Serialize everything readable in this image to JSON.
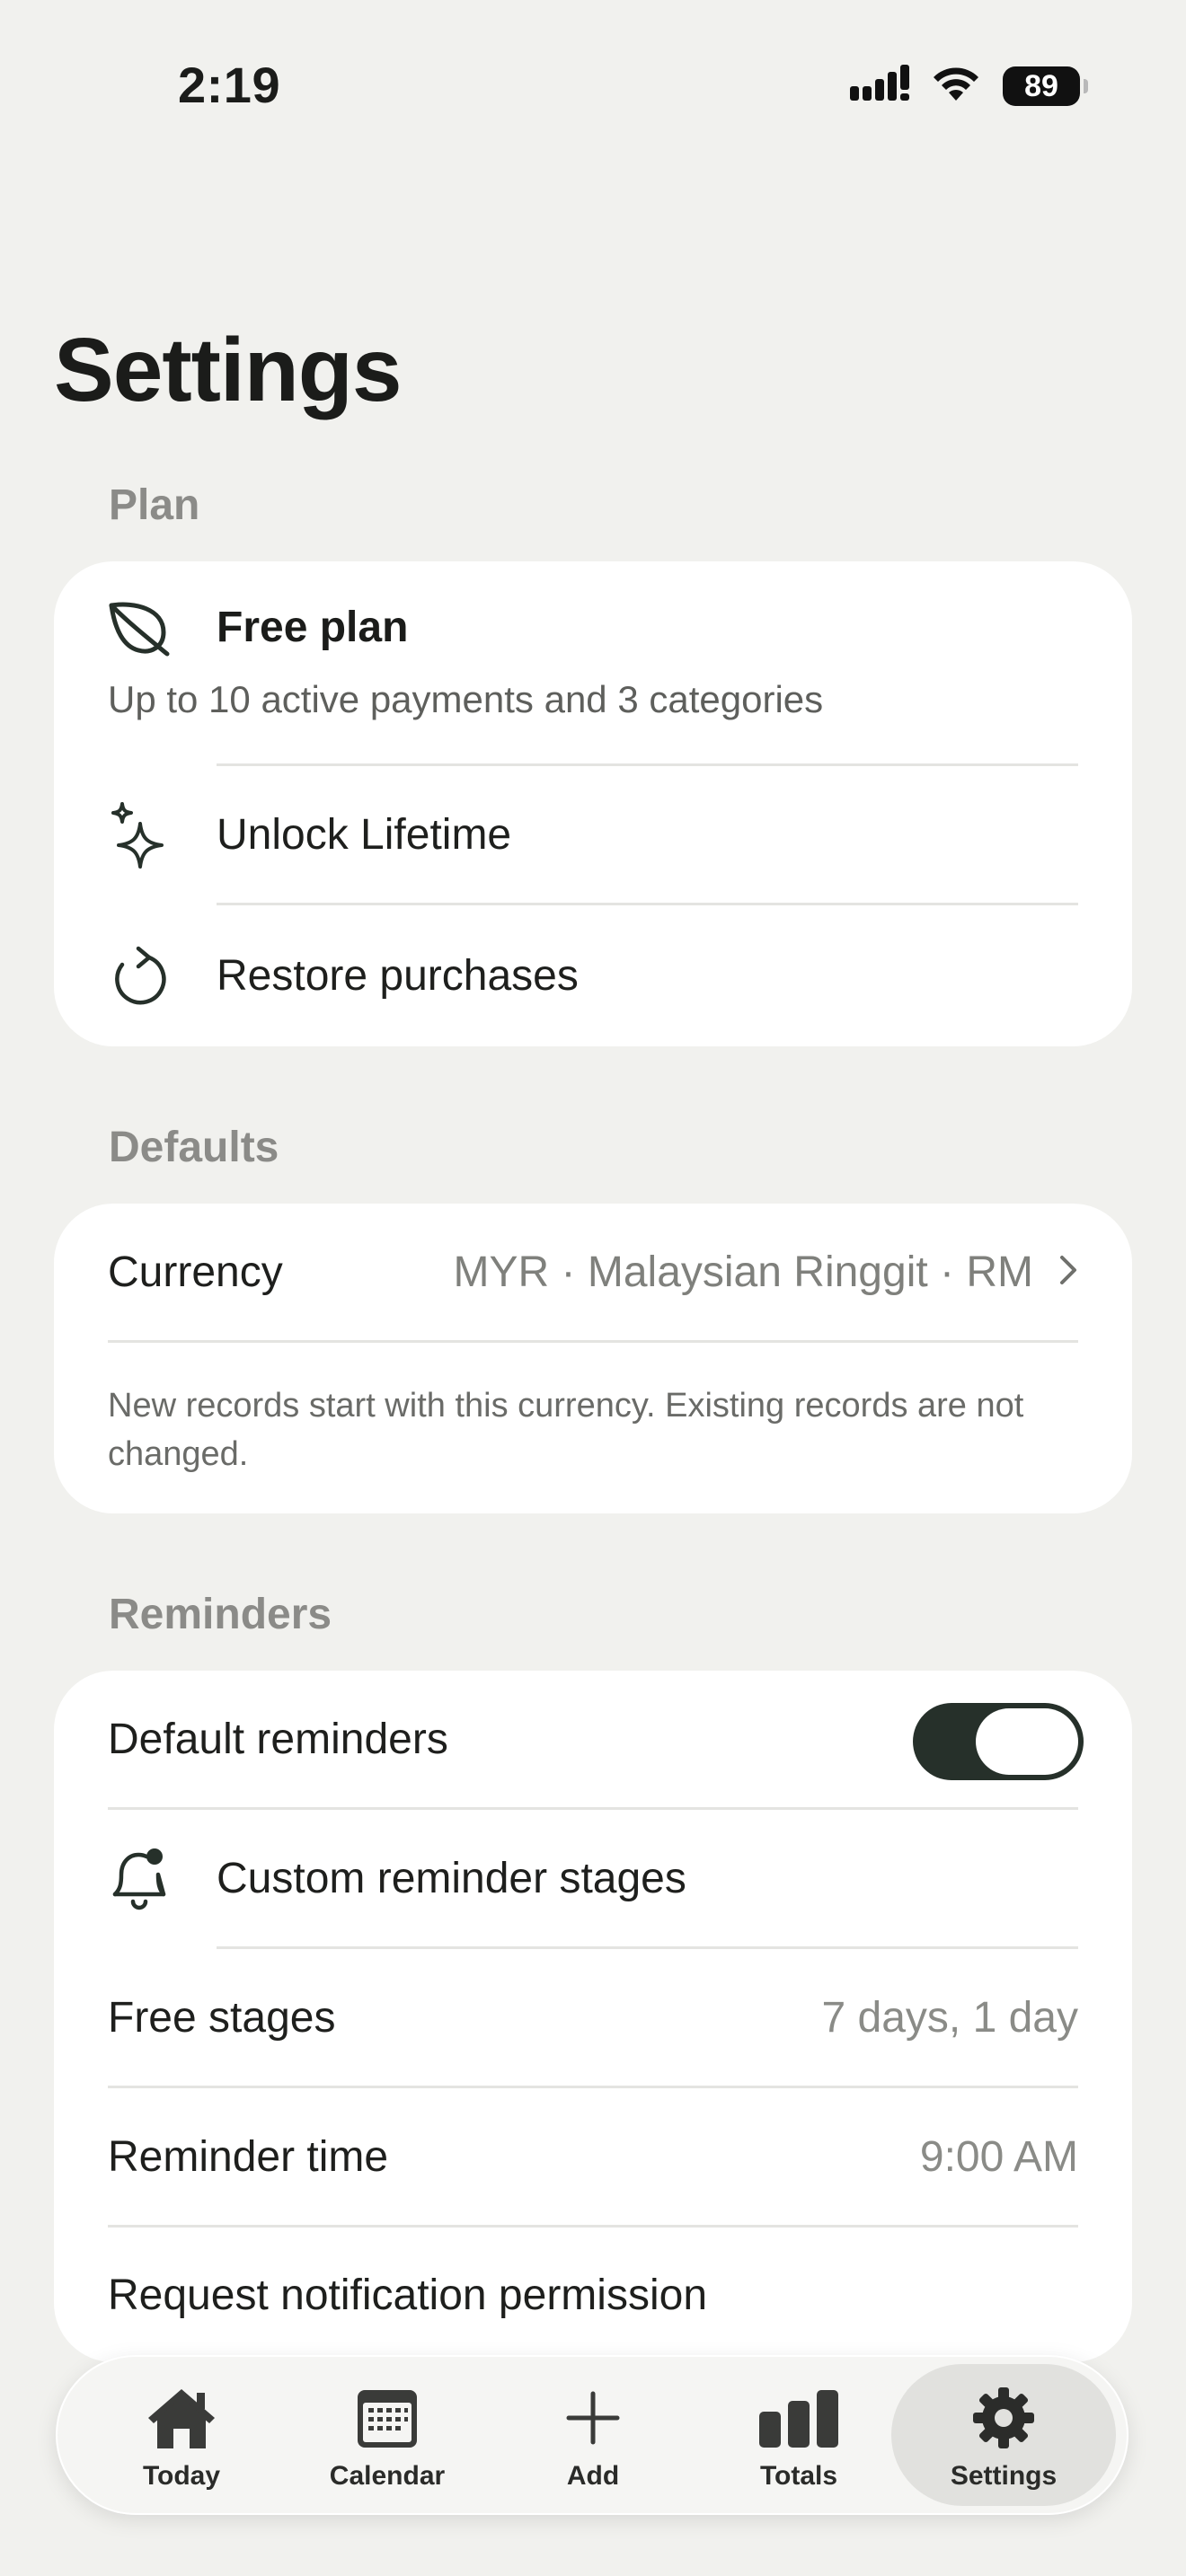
{
  "status_bar": {
    "time": "2:19",
    "battery": "89",
    "icons": [
      "cellular-signal-icon",
      "wifi-icon",
      "battery-icon"
    ]
  },
  "page": {
    "title": "Settings"
  },
  "plan": {
    "header": "Plan",
    "free_plan_title": "Free plan",
    "free_plan_desc": "Up to 10 active payments and 3 categories",
    "unlock_label": "Unlock Lifetime",
    "restore_label": "Restore purchases"
  },
  "defaults": {
    "header": "Defaults",
    "currency_label": "Currency",
    "currency_value": "MYR · Malaysian Ringgit · RM",
    "currency_note": "New records start with this currency. Existing records are not changed."
  },
  "reminders": {
    "header": "Reminders",
    "default_reminders_label": "Default reminders",
    "default_reminders_on": true,
    "custom_stages_label": "Custom reminder stages",
    "free_stages_label": "Free stages",
    "free_stages_value": "7 days, 1 day",
    "reminder_time_label": "Reminder time",
    "reminder_time_value": "9:00 AM",
    "permission_label": "Request notification permission"
  },
  "tab_bar": {
    "tabs": [
      {
        "label": "Today",
        "icon": "house-icon"
      },
      {
        "label": "Calendar",
        "icon": "calendar-icon"
      },
      {
        "label": "Add",
        "icon": "plus-icon"
      },
      {
        "label": "Totals",
        "icon": "bar-chart-icon"
      },
      {
        "label": "Settings",
        "icon": "gear-icon",
        "active": true
      }
    ]
  },
  "colors": {
    "background": "#f1f1ee",
    "card": "#ffffff",
    "accent_dark": "#26302a",
    "secondary_text": "#8b8b88"
  }
}
